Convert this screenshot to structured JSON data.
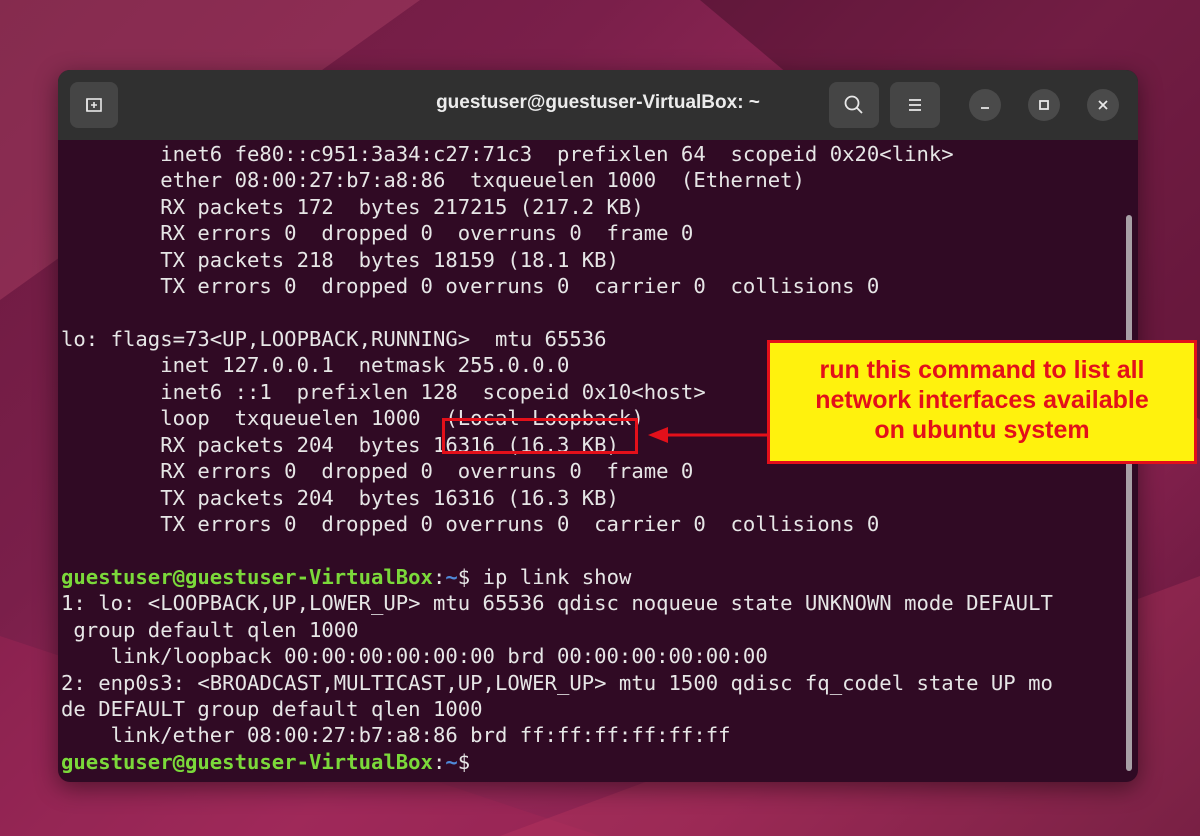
{
  "window": {
    "title": "guestuser@guestuser-VirtualBox: ~",
    "new_tab_icon": "new-tab-icon",
    "search_icon": "search-icon",
    "menu_icon": "hamburger-menu-icon",
    "minimize_icon": "minimize-icon",
    "maximize_icon": "maximize-icon",
    "close_icon": "close-icon"
  },
  "terminal": {
    "prompt": {
      "user": "guestuser@guestuser-VirtualBox",
      "sep": ":",
      "cwd": "~",
      "sign": "$ "
    },
    "output_before": [
      "        inet6 fe80::c951:3a34:c27:71c3  prefixlen 64  scopeid 0x20<link>",
      "        ether 08:00:27:b7:a8:86  txqueuelen 1000  (Ethernet)",
      "        RX packets 172  bytes 217215 (217.2 KB)",
      "        RX errors 0  dropped 0  overruns 0  frame 0",
      "        TX packets 218  bytes 18159 (18.1 KB)",
      "        TX errors 0  dropped 0 overruns 0  carrier 0  collisions 0",
      "",
      "lo: flags=73<UP,LOOPBACK,RUNNING>  mtu 65536",
      "        inet 127.0.0.1  netmask 255.0.0.0",
      "        inet6 ::1  prefixlen 128  scopeid 0x10<host>",
      "        loop  txqueuelen 1000  (Local Loopback)",
      "        RX packets 204  bytes 16316 (16.3 KB)",
      "        RX errors 0  dropped 0  overruns 0  frame 0",
      "        TX packets 204  bytes 16316 (16.3 KB)",
      "        TX errors 0  dropped 0 overruns 0  carrier 0  collisions 0",
      ""
    ],
    "command": "ip link show",
    "output_after": [
      "1: lo: <LOOPBACK,UP,LOWER_UP> mtu 65536 qdisc noqueue state UNKNOWN mode DEFAULT",
      " group default qlen 1000",
      "    link/loopback 00:00:00:00:00:00 brd 00:00:00:00:00:00",
      "2: enp0s3: <BROADCAST,MULTICAST,UP,LOWER_UP> mtu 1500 qdisc fq_codel state UP mo",
      "de DEFAULT group default qlen 1000",
      "    link/ether 08:00:27:b7:a8:86 brd ff:ff:ff:ff:ff:ff"
    ]
  },
  "annotation": {
    "callout_lines": [
      "run this command to list all",
      "network interfaces available",
      "on ubuntu system"
    ],
    "highlight_color": "#e3101a",
    "callout_bg": "#fff20d"
  },
  "colors": {
    "terminal_bg": "#300a24",
    "titlebar_bg": "#303030",
    "prompt_user": "#7bd93a",
    "prompt_cwd": "#4f89d8"
  }
}
